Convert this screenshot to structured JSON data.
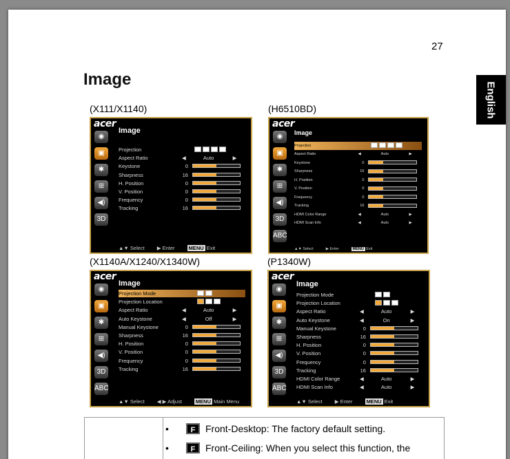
{
  "page": {
    "number": "27",
    "title": "Image",
    "language_tab": "English"
  },
  "osd_common": {
    "logo": "acer"
  },
  "panels": [
    {
      "model": "(X111/X1140)",
      "menu_title": "Image",
      "rows": [
        {
          "label": "Projection",
          "type": "icons"
        },
        {
          "label": "Aspect Ratio",
          "type": "select",
          "value": "Auto"
        },
        {
          "label": "Keystone",
          "type": "bar",
          "value": "0",
          "level": 0.5
        },
        {
          "label": "Sharpness",
          "type": "bar",
          "value": "16",
          "level": 0.5
        },
        {
          "label": "H. Position",
          "type": "bar",
          "value": "0",
          "level": 0.5
        },
        {
          "label": "V. Position",
          "type": "bar",
          "value": "0",
          "level": 0.5
        },
        {
          "label": "Frequency",
          "type": "bar",
          "value": "0",
          "level": 0.5
        },
        {
          "label": "Tracking",
          "type": "bar",
          "value": "16",
          "level": 0.5
        }
      ],
      "footer": [
        "▲▼ Select",
        "▶ Enter",
        "MENU",
        "Exit"
      ]
    },
    {
      "model": "(H6510BD)",
      "menu_title": "Image",
      "rows": [
        {
          "label": "Projection",
          "type": "icons",
          "highlight": true
        },
        {
          "label": "Aspect Ratio",
          "type": "select",
          "value": "Auto"
        },
        {
          "label": "Keystone",
          "type": "bar",
          "value": "0",
          "level": 0.3
        },
        {
          "label": "Sharpness",
          "type": "bar",
          "value": "16",
          "level": 0.3
        },
        {
          "label": "H. Position",
          "type": "bar",
          "value": "0",
          "level": 0.3
        },
        {
          "label": "V. Position",
          "type": "bar",
          "value": "0",
          "level": 0.3
        },
        {
          "label": "Frequency",
          "type": "bar",
          "value": "0",
          "level": 0.3
        },
        {
          "label": "Tracking",
          "type": "bar",
          "value": "16",
          "level": 0.3
        },
        {
          "label": "HDMI Color Range",
          "type": "select",
          "value": "Auto"
        },
        {
          "label": "HDMI Scan Info",
          "type": "select",
          "value": "Auto"
        }
      ],
      "footer": [
        "▲▼ Select",
        "▶ Enter",
        "MENU",
        "Exit"
      ]
    },
    {
      "model": "(X1140A/X1240/X1340W)",
      "menu_title": "Image",
      "rows": [
        {
          "label": "Projection Mode",
          "type": "icons2",
          "highlight": true
        },
        {
          "label": "Projection Location",
          "type": "icons3"
        },
        {
          "label": "Aspect Ratio",
          "type": "select",
          "value": "Auto"
        },
        {
          "label": "Auto Keystone",
          "type": "select",
          "value": "Off"
        },
        {
          "label": "Manual Keystone",
          "type": "bar",
          "value": "0",
          "level": 0.5
        },
        {
          "label": "Sharpness",
          "type": "bar",
          "value": "16",
          "level": 0.5
        },
        {
          "label": "H. Position",
          "type": "bar",
          "value": "0",
          "level": 0.5
        },
        {
          "label": "V. Position",
          "type": "bar",
          "value": "0",
          "level": 0.5
        },
        {
          "label": "Frequency",
          "type": "bar",
          "value": "0",
          "level": 0.5
        },
        {
          "label": "Tracking",
          "type": "bar",
          "value": "16",
          "level": 0.5
        }
      ],
      "footer": [
        "▲▼ Select",
        "◀ ▶ Adjust",
        "MENU",
        "Main Menu"
      ]
    },
    {
      "model": "(P1340W)",
      "menu_title": "Image",
      "rows": [
        {
          "label": "Projection Mode",
          "type": "icons2"
        },
        {
          "label": "Projection Location",
          "type": "icons3"
        },
        {
          "label": "Aspect Ratio",
          "type": "select",
          "value": "Auto"
        },
        {
          "label": "Auto Keystone",
          "type": "select",
          "value": "On"
        },
        {
          "label": "Manual Keystone",
          "type": "bar",
          "value": "0",
          "level": 0.5
        },
        {
          "label": "Sharpness",
          "type": "bar",
          "value": "16",
          "level": 0.5
        },
        {
          "label": "H. Position",
          "type": "bar",
          "value": "0",
          "level": 0.5
        },
        {
          "label": "V. Position",
          "type": "bar",
          "value": "0",
          "level": 0.5
        },
        {
          "label": "Frequency",
          "type": "bar",
          "value": "0",
          "level": 0.5
        },
        {
          "label": "Tracking",
          "type": "bar",
          "value": "16",
          "level": 0.5
        },
        {
          "label": "HDMI Color Range",
          "type": "select",
          "value": "Auto"
        },
        {
          "label": "HDMI Scan Info",
          "type": "select",
          "value": "Auto"
        }
      ],
      "footer": [
        "▲▼ Select",
        "▶ Enter",
        "MENU",
        "Exit"
      ]
    }
  ],
  "table": {
    "items": [
      {
        "badge": "F",
        "text": "Front-Desktop: The factory default setting."
      },
      {
        "badge": "F",
        "text": "Front-Ceiling: When you select this function, the"
      }
    ]
  },
  "colors": {
    "accent": "#f2a93b",
    "osd_border": "#c8a24a",
    "osd_bg": "#000000"
  }
}
